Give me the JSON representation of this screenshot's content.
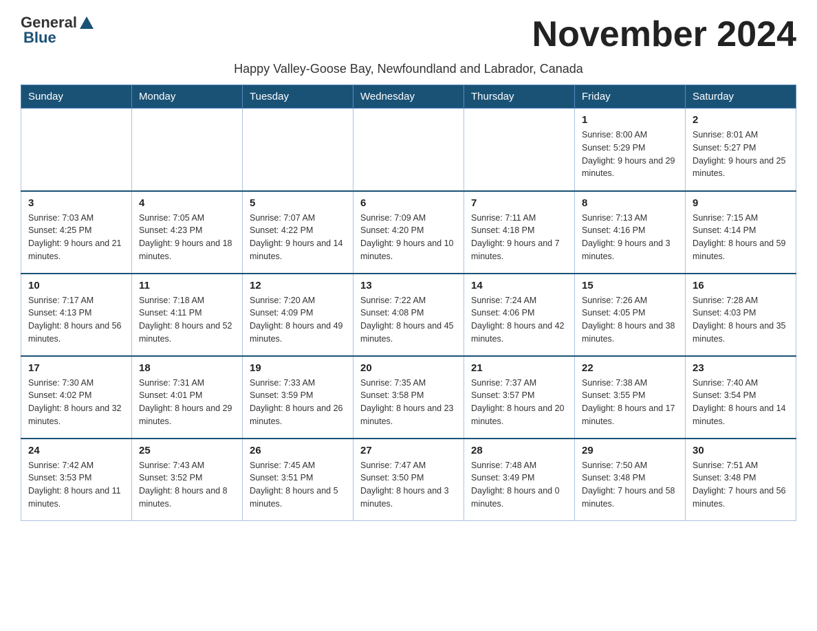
{
  "logo": {
    "general": "General",
    "blue": "Blue"
  },
  "title": "November 2024",
  "subtitle": "Happy Valley-Goose Bay, Newfoundland and Labrador, Canada",
  "days_of_week": [
    "Sunday",
    "Monday",
    "Tuesday",
    "Wednesday",
    "Thursday",
    "Friday",
    "Saturday"
  ],
  "weeks": [
    [
      {
        "day": "",
        "info": ""
      },
      {
        "day": "",
        "info": ""
      },
      {
        "day": "",
        "info": ""
      },
      {
        "day": "",
        "info": ""
      },
      {
        "day": "",
        "info": ""
      },
      {
        "day": "1",
        "info": "Sunrise: 8:00 AM\nSunset: 5:29 PM\nDaylight: 9 hours and 29 minutes."
      },
      {
        "day": "2",
        "info": "Sunrise: 8:01 AM\nSunset: 5:27 PM\nDaylight: 9 hours and 25 minutes."
      }
    ],
    [
      {
        "day": "3",
        "info": "Sunrise: 7:03 AM\nSunset: 4:25 PM\nDaylight: 9 hours and 21 minutes."
      },
      {
        "day": "4",
        "info": "Sunrise: 7:05 AM\nSunset: 4:23 PM\nDaylight: 9 hours and 18 minutes."
      },
      {
        "day": "5",
        "info": "Sunrise: 7:07 AM\nSunset: 4:22 PM\nDaylight: 9 hours and 14 minutes."
      },
      {
        "day": "6",
        "info": "Sunrise: 7:09 AM\nSunset: 4:20 PM\nDaylight: 9 hours and 10 minutes."
      },
      {
        "day": "7",
        "info": "Sunrise: 7:11 AM\nSunset: 4:18 PM\nDaylight: 9 hours and 7 minutes."
      },
      {
        "day": "8",
        "info": "Sunrise: 7:13 AM\nSunset: 4:16 PM\nDaylight: 9 hours and 3 minutes."
      },
      {
        "day": "9",
        "info": "Sunrise: 7:15 AM\nSunset: 4:14 PM\nDaylight: 8 hours and 59 minutes."
      }
    ],
    [
      {
        "day": "10",
        "info": "Sunrise: 7:17 AM\nSunset: 4:13 PM\nDaylight: 8 hours and 56 minutes."
      },
      {
        "day": "11",
        "info": "Sunrise: 7:18 AM\nSunset: 4:11 PM\nDaylight: 8 hours and 52 minutes."
      },
      {
        "day": "12",
        "info": "Sunrise: 7:20 AM\nSunset: 4:09 PM\nDaylight: 8 hours and 49 minutes."
      },
      {
        "day": "13",
        "info": "Sunrise: 7:22 AM\nSunset: 4:08 PM\nDaylight: 8 hours and 45 minutes."
      },
      {
        "day": "14",
        "info": "Sunrise: 7:24 AM\nSunset: 4:06 PM\nDaylight: 8 hours and 42 minutes."
      },
      {
        "day": "15",
        "info": "Sunrise: 7:26 AM\nSunset: 4:05 PM\nDaylight: 8 hours and 38 minutes."
      },
      {
        "day": "16",
        "info": "Sunrise: 7:28 AM\nSunset: 4:03 PM\nDaylight: 8 hours and 35 minutes."
      }
    ],
    [
      {
        "day": "17",
        "info": "Sunrise: 7:30 AM\nSunset: 4:02 PM\nDaylight: 8 hours and 32 minutes."
      },
      {
        "day": "18",
        "info": "Sunrise: 7:31 AM\nSunset: 4:01 PM\nDaylight: 8 hours and 29 minutes."
      },
      {
        "day": "19",
        "info": "Sunrise: 7:33 AM\nSunset: 3:59 PM\nDaylight: 8 hours and 26 minutes."
      },
      {
        "day": "20",
        "info": "Sunrise: 7:35 AM\nSunset: 3:58 PM\nDaylight: 8 hours and 23 minutes."
      },
      {
        "day": "21",
        "info": "Sunrise: 7:37 AM\nSunset: 3:57 PM\nDaylight: 8 hours and 20 minutes."
      },
      {
        "day": "22",
        "info": "Sunrise: 7:38 AM\nSunset: 3:55 PM\nDaylight: 8 hours and 17 minutes."
      },
      {
        "day": "23",
        "info": "Sunrise: 7:40 AM\nSunset: 3:54 PM\nDaylight: 8 hours and 14 minutes."
      }
    ],
    [
      {
        "day": "24",
        "info": "Sunrise: 7:42 AM\nSunset: 3:53 PM\nDaylight: 8 hours and 11 minutes."
      },
      {
        "day": "25",
        "info": "Sunrise: 7:43 AM\nSunset: 3:52 PM\nDaylight: 8 hours and 8 minutes."
      },
      {
        "day": "26",
        "info": "Sunrise: 7:45 AM\nSunset: 3:51 PM\nDaylight: 8 hours and 5 minutes."
      },
      {
        "day": "27",
        "info": "Sunrise: 7:47 AM\nSunset: 3:50 PM\nDaylight: 8 hours and 3 minutes."
      },
      {
        "day": "28",
        "info": "Sunrise: 7:48 AM\nSunset: 3:49 PM\nDaylight: 8 hours and 0 minutes."
      },
      {
        "day": "29",
        "info": "Sunrise: 7:50 AM\nSunset: 3:48 PM\nDaylight: 7 hours and 58 minutes."
      },
      {
        "day": "30",
        "info": "Sunrise: 7:51 AM\nSunset: 3:48 PM\nDaylight: 7 hours and 56 minutes."
      }
    ]
  ]
}
